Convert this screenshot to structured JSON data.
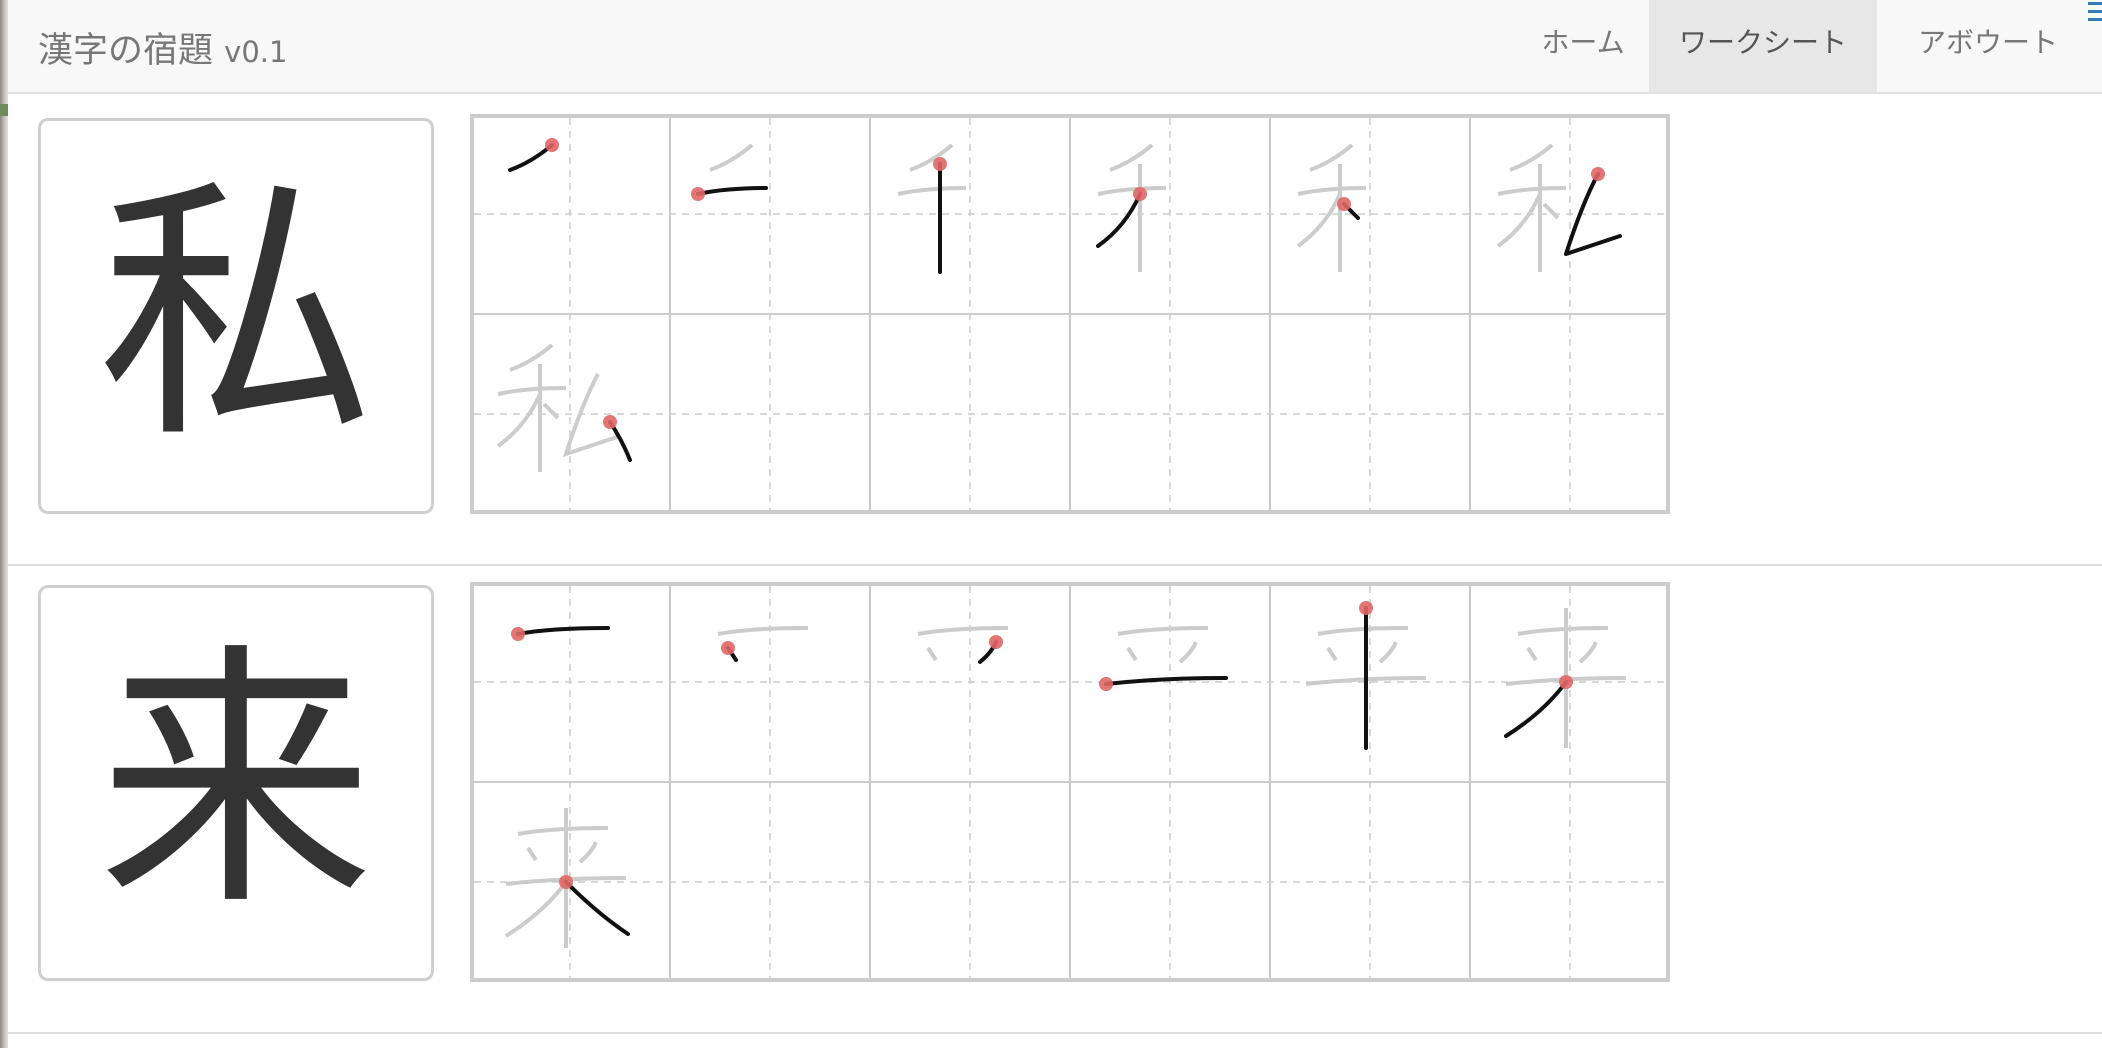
{
  "navbar": {
    "brand_title": "漢字の宿題",
    "brand_version": "v0.1",
    "items": [
      {
        "label": "ホーム",
        "active": false
      },
      {
        "label": "ワークシート",
        "active": true
      },
      {
        "label": "アボウート",
        "active": false
      }
    ]
  },
  "colors": {
    "navbar_bg": "#f8f8f8",
    "active_tab_bg": "#e7e7e7",
    "stroke_current": "#111111",
    "stroke_ghost": "#cccccc",
    "stroke_start_dot": "#e06666",
    "menu_icon": "#337ab7"
  },
  "worksheet": {
    "rows": [
      {
        "kanji": "私",
        "stroke_count": 7,
        "columns": 6,
        "grid_rows": 2
      },
      {
        "kanji": "来",
        "stroke_count": 7,
        "columns": 6,
        "grid_rows": 2
      }
    ]
  }
}
